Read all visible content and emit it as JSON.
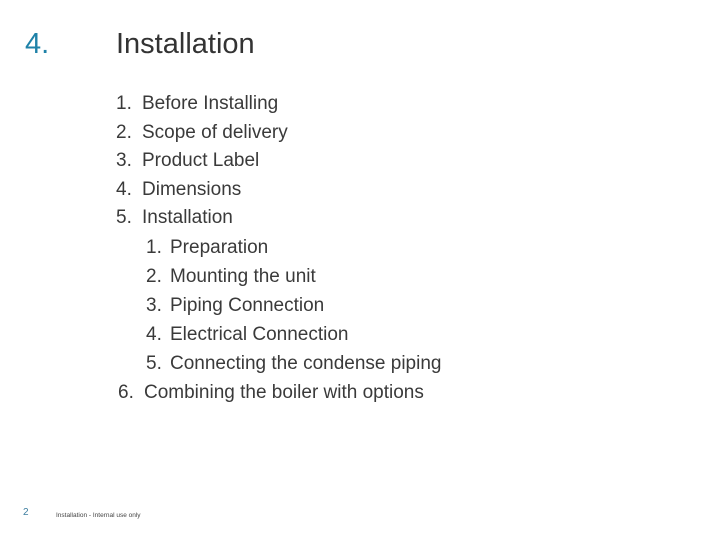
{
  "slide": {
    "section_number": "4.",
    "section_title": "Installation",
    "accent_color": "#1f82a8"
  },
  "toc": {
    "items": [
      {
        "num": "1.",
        "label": "Before Installing"
      },
      {
        "num": "2.",
        "label": "Scope of delivery"
      },
      {
        "num": "3.",
        "label": "Product Label"
      },
      {
        "num": "4.",
        "label": "Dimensions"
      },
      {
        "num": "5.",
        "label": "Installation"
      }
    ],
    "subitems": [
      {
        "num": "1.",
        "label": "Preparation"
      },
      {
        "num": "2.",
        "label": "Mounting the unit"
      },
      {
        "num": "3.",
        "label": "Piping Connection"
      },
      {
        "num": "4.",
        "label": "Electrical Connection"
      },
      {
        "num": "5.",
        "label": "Connecting the condense piping"
      }
    ],
    "last_item": {
      "num": "6.",
      "label": "Combining the boiler with options"
    }
  },
  "footer": {
    "page_number": "2",
    "text": "Installation - Internal use only"
  }
}
